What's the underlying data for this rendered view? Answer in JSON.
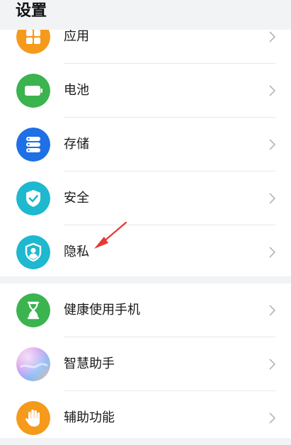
{
  "header": {
    "title": "设置"
  },
  "group1": [
    {
      "label": "应用",
      "icon": "apps-icon",
      "color": "#f59a1b"
    },
    {
      "label": "电池",
      "icon": "battery-icon",
      "color": "#3bb34f"
    },
    {
      "label": "存储",
      "icon": "storage-icon",
      "color": "#1f6fe5"
    },
    {
      "label": "安全",
      "icon": "shield-check-icon",
      "color": "#1eb8cf"
    },
    {
      "label": "隐私",
      "icon": "privacy-icon",
      "color": "#1eb8cf"
    }
  ],
  "group2": [
    {
      "label": "健康使用手机",
      "icon": "hourglass-icon",
      "color": "#3bb34f"
    },
    {
      "label": "智慧助手",
      "icon": "smart-assistant-icon",
      "color": "#c978e6"
    },
    {
      "label": "辅助功能",
      "icon": "hand-icon",
      "color": "#f59a1b"
    }
  ],
  "annotation": {
    "arrow_color": "#e53935"
  }
}
